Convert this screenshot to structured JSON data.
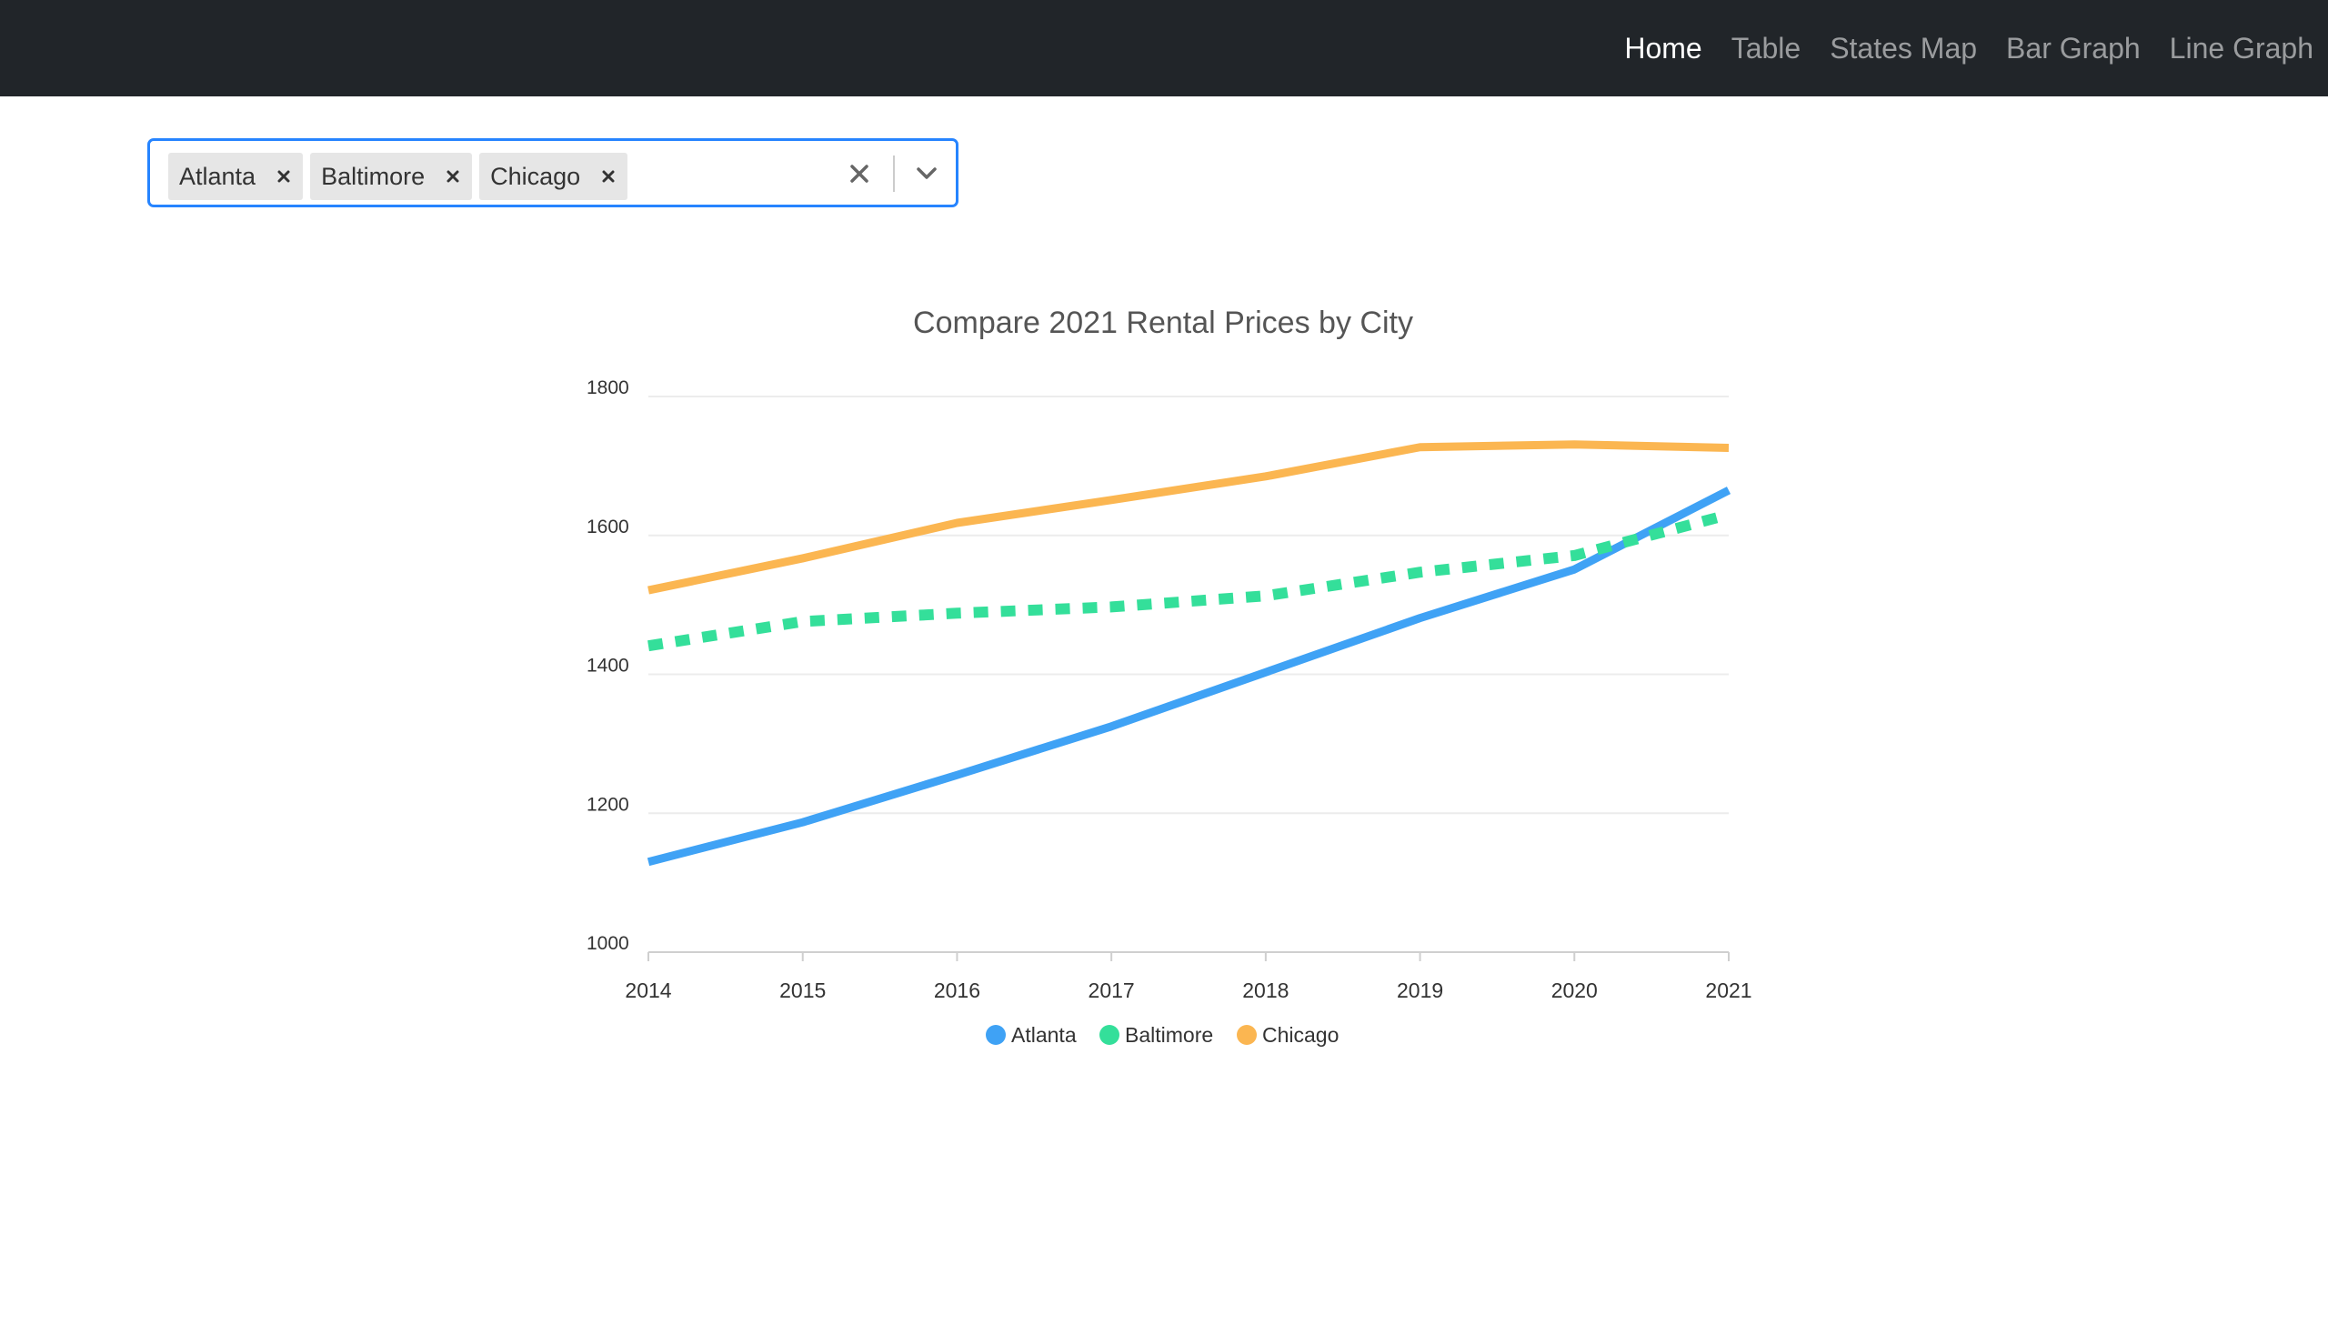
{
  "nav": {
    "items": [
      {
        "label": "Home",
        "active": true
      },
      {
        "label": "Table",
        "active": false
      },
      {
        "label": "States Map",
        "active": false
      },
      {
        "label": "Bar Graph",
        "active": false
      },
      {
        "label": "Line Graph",
        "active": false
      }
    ]
  },
  "select": {
    "chips": [
      {
        "label": "Atlanta"
      },
      {
        "label": "Baltimore"
      },
      {
        "label": "Chicago"
      }
    ],
    "clear_icon": "close-icon",
    "dropdown_icon": "chevron-down-icon",
    "accent_color": "#2684ff"
  },
  "chart_data": {
    "type": "line",
    "title": "Compare 2021 Rental Prices by City",
    "xlabel": "",
    "ylabel": "",
    "x": [
      "2014",
      "2015",
      "2016",
      "2017",
      "2018",
      "2019",
      "2020",
      "2021"
    ],
    "ylim": [
      1000,
      1800
    ],
    "yticks": [
      "1800",
      "1600",
      "1400",
      "1200",
      "1000"
    ],
    "grid": true,
    "legend_position": "bottom",
    "series": [
      {
        "name": "Atlanta",
        "color": "#3fa2f5",
        "dashed": false,
        "values": [
          1130,
          1187,
          1255,
          1325,
          1403,
          1481,
          1551,
          1665
        ]
      },
      {
        "name": "Baltimore",
        "color": "#34df9a",
        "dashed": true,
        "values": [
          1441,
          1476,
          1488,
          1497,
          1513,
          1547,
          1571,
          1630
        ]
      },
      {
        "name": "Chicago",
        "color": "#fbb651",
        "dashed": false,
        "values": [
          1521,
          1567,
          1618,
          1651,
          1685,
          1727,
          1731,
          1726
        ]
      }
    ]
  }
}
